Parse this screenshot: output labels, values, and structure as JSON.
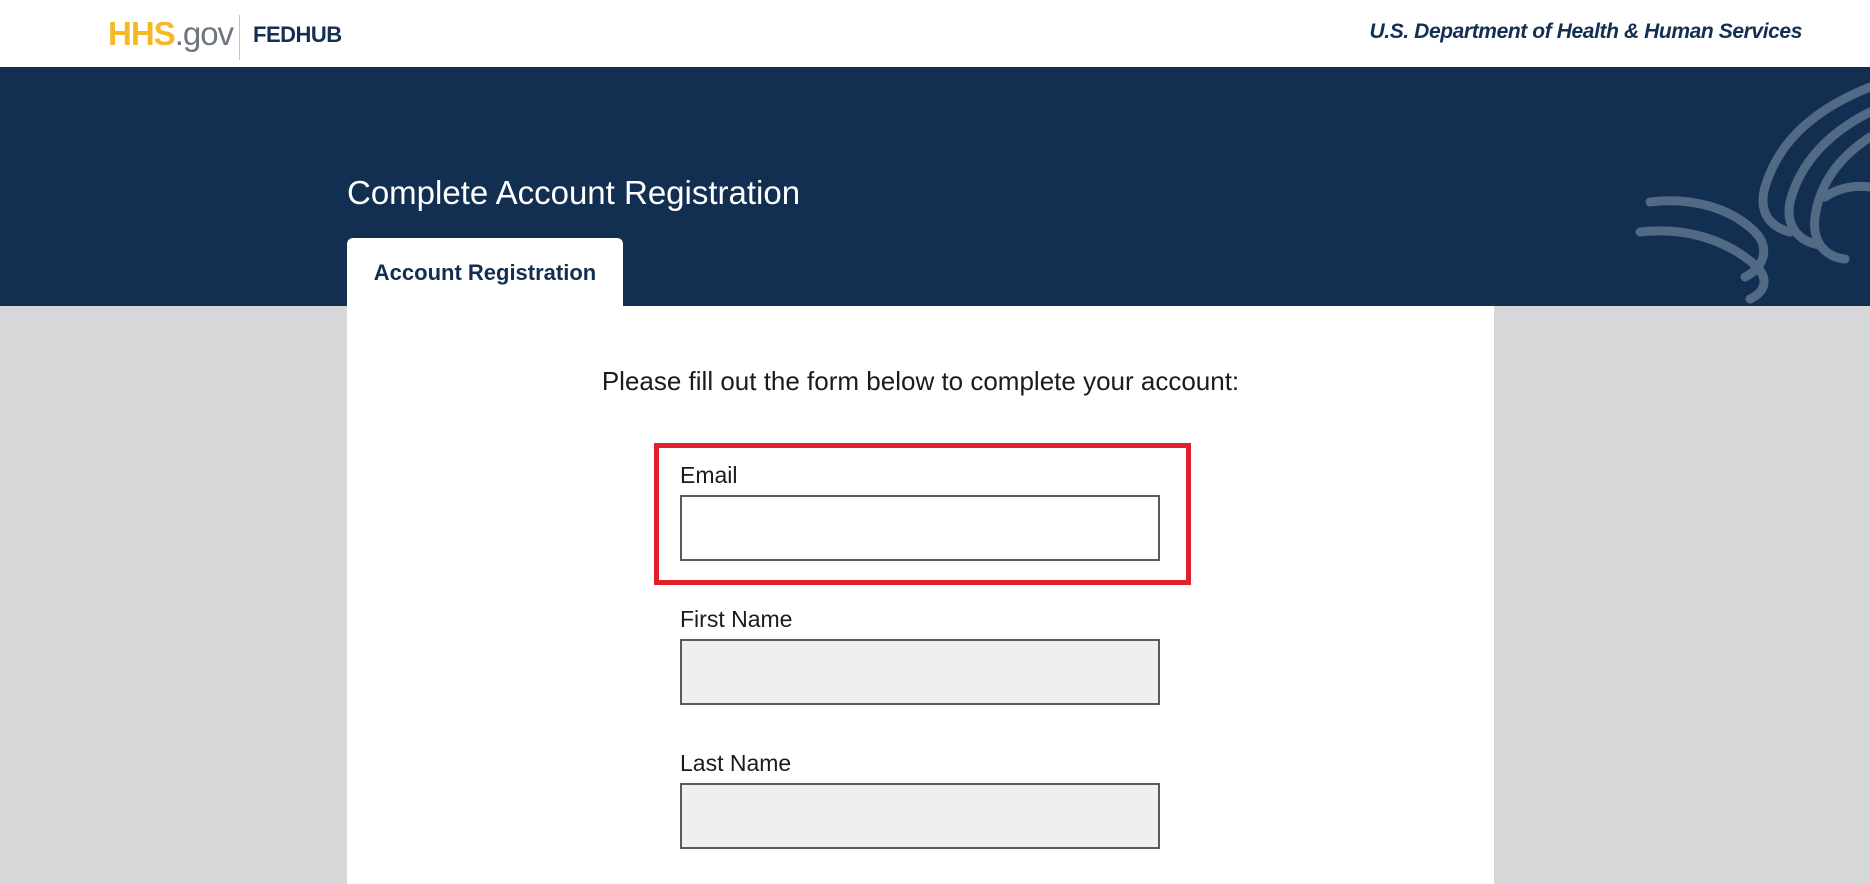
{
  "header": {
    "logo_hhs": "HHS",
    "logo_gov": ".gov",
    "logo_fedhub": "FEDHUB",
    "department_link": "U.S. Department of Health & Human Services"
  },
  "banner": {
    "title": "Complete Account Registration"
  },
  "tabs": [
    {
      "label": "Account Registration",
      "active": true
    }
  ],
  "form": {
    "intro": "Please fill out the form below to complete your account:",
    "fields": [
      {
        "label": "Email",
        "value": "",
        "placeholder": "",
        "disabled": false,
        "highlighted": true
      },
      {
        "label": "First Name",
        "value": "",
        "placeholder": "",
        "disabled": true
      },
      {
        "label": "Last Name",
        "value": "",
        "placeholder": "",
        "disabled": true
      }
    ]
  },
  "colors": {
    "navy": "#122e51",
    "hhs_gold": "#f5b827",
    "highlight_red": "#e0202a",
    "page_gray": "#d6d7d9",
    "disabled_field": "#efeff0"
  }
}
